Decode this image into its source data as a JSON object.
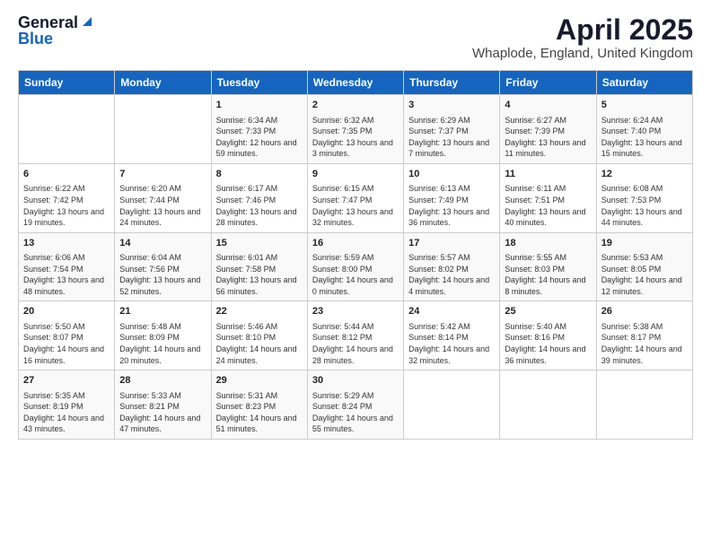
{
  "logo": {
    "general": "General",
    "blue": "Blue"
  },
  "title": "April 2025",
  "subtitle": "Whaplode, England, United Kingdom",
  "days_of_week": [
    "Sunday",
    "Monday",
    "Tuesday",
    "Wednesday",
    "Thursday",
    "Friday",
    "Saturday"
  ],
  "weeks": [
    [
      {
        "day": "",
        "sunrise": "",
        "sunset": "",
        "daylight": ""
      },
      {
        "day": "",
        "sunrise": "",
        "sunset": "",
        "daylight": ""
      },
      {
        "day": "1",
        "sunrise": "Sunrise: 6:34 AM",
        "sunset": "Sunset: 7:33 PM",
        "daylight": "Daylight: 12 hours and 59 minutes."
      },
      {
        "day": "2",
        "sunrise": "Sunrise: 6:32 AM",
        "sunset": "Sunset: 7:35 PM",
        "daylight": "Daylight: 13 hours and 3 minutes."
      },
      {
        "day": "3",
        "sunrise": "Sunrise: 6:29 AM",
        "sunset": "Sunset: 7:37 PM",
        "daylight": "Daylight: 13 hours and 7 minutes."
      },
      {
        "day": "4",
        "sunrise": "Sunrise: 6:27 AM",
        "sunset": "Sunset: 7:39 PM",
        "daylight": "Daylight: 13 hours and 11 minutes."
      },
      {
        "day": "5",
        "sunrise": "Sunrise: 6:24 AM",
        "sunset": "Sunset: 7:40 PM",
        "daylight": "Daylight: 13 hours and 15 minutes."
      }
    ],
    [
      {
        "day": "6",
        "sunrise": "Sunrise: 6:22 AM",
        "sunset": "Sunset: 7:42 PM",
        "daylight": "Daylight: 13 hours and 19 minutes."
      },
      {
        "day": "7",
        "sunrise": "Sunrise: 6:20 AM",
        "sunset": "Sunset: 7:44 PM",
        "daylight": "Daylight: 13 hours and 24 minutes."
      },
      {
        "day": "8",
        "sunrise": "Sunrise: 6:17 AM",
        "sunset": "Sunset: 7:46 PM",
        "daylight": "Daylight: 13 hours and 28 minutes."
      },
      {
        "day": "9",
        "sunrise": "Sunrise: 6:15 AM",
        "sunset": "Sunset: 7:47 PM",
        "daylight": "Daylight: 13 hours and 32 minutes."
      },
      {
        "day": "10",
        "sunrise": "Sunrise: 6:13 AM",
        "sunset": "Sunset: 7:49 PM",
        "daylight": "Daylight: 13 hours and 36 minutes."
      },
      {
        "day": "11",
        "sunrise": "Sunrise: 6:11 AM",
        "sunset": "Sunset: 7:51 PM",
        "daylight": "Daylight: 13 hours and 40 minutes."
      },
      {
        "day": "12",
        "sunrise": "Sunrise: 6:08 AM",
        "sunset": "Sunset: 7:53 PM",
        "daylight": "Daylight: 13 hours and 44 minutes."
      }
    ],
    [
      {
        "day": "13",
        "sunrise": "Sunrise: 6:06 AM",
        "sunset": "Sunset: 7:54 PM",
        "daylight": "Daylight: 13 hours and 48 minutes."
      },
      {
        "day": "14",
        "sunrise": "Sunrise: 6:04 AM",
        "sunset": "Sunset: 7:56 PM",
        "daylight": "Daylight: 13 hours and 52 minutes."
      },
      {
        "day": "15",
        "sunrise": "Sunrise: 6:01 AM",
        "sunset": "Sunset: 7:58 PM",
        "daylight": "Daylight: 13 hours and 56 minutes."
      },
      {
        "day": "16",
        "sunrise": "Sunrise: 5:59 AM",
        "sunset": "Sunset: 8:00 PM",
        "daylight": "Daylight: 14 hours and 0 minutes."
      },
      {
        "day": "17",
        "sunrise": "Sunrise: 5:57 AM",
        "sunset": "Sunset: 8:02 PM",
        "daylight": "Daylight: 14 hours and 4 minutes."
      },
      {
        "day": "18",
        "sunrise": "Sunrise: 5:55 AM",
        "sunset": "Sunset: 8:03 PM",
        "daylight": "Daylight: 14 hours and 8 minutes."
      },
      {
        "day": "19",
        "sunrise": "Sunrise: 5:53 AM",
        "sunset": "Sunset: 8:05 PM",
        "daylight": "Daylight: 14 hours and 12 minutes."
      }
    ],
    [
      {
        "day": "20",
        "sunrise": "Sunrise: 5:50 AM",
        "sunset": "Sunset: 8:07 PM",
        "daylight": "Daylight: 14 hours and 16 minutes."
      },
      {
        "day": "21",
        "sunrise": "Sunrise: 5:48 AM",
        "sunset": "Sunset: 8:09 PM",
        "daylight": "Daylight: 14 hours and 20 minutes."
      },
      {
        "day": "22",
        "sunrise": "Sunrise: 5:46 AM",
        "sunset": "Sunset: 8:10 PM",
        "daylight": "Daylight: 14 hours and 24 minutes."
      },
      {
        "day": "23",
        "sunrise": "Sunrise: 5:44 AM",
        "sunset": "Sunset: 8:12 PM",
        "daylight": "Daylight: 14 hours and 28 minutes."
      },
      {
        "day": "24",
        "sunrise": "Sunrise: 5:42 AM",
        "sunset": "Sunset: 8:14 PM",
        "daylight": "Daylight: 14 hours and 32 minutes."
      },
      {
        "day": "25",
        "sunrise": "Sunrise: 5:40 AM",
        "sunset": "Sunset: 8:16 PM",
        "daylight": "Daylight: 14 hours and 36 minutes."
      },
      {
        "day": "26",
        "sunrise": "Sunrise: 5:38 AM",
        "sunset": "Sunset: 8:17 PM",
        "daylight": "Daylight: 14 hours and 39 minutes."
      }
    ],
    [
      {
        "day": "27",
        "sunrise": "Sunrise: 5:35 AM",
        "sunset": "Sunset: 8:19 PM",
        "daylight": "Daylight: 14 hours and 43 minutes."
      },
      {
        "day": "28",
        "sunrise": "Sunrise: 5:33 AM",
        "sunset": "Sunset: 8:21 PM",
        "daylight": "Daylight: 14 hours and 47 minutes."
      },
      {
        "day": "29",
        "sunrise": "Sunrise: 5:31 AM",
        "sunset": "Sunset: 8:23 PM",
        "daylight": "Daylight: 14 hours and 51 minutes."
      },
      {
        "day": "30",
        "sunrise": "Sunrise: 5:29 AM",
        "sunset": "Sunset: 8:24 PM",
        "daylight": "Daylight: 14 hours and 55 minutes."
      },
      {
        "day": "",
        "sunrise": "",
        "sunset": "",
        "daylight": ""
      },
      {
        "day": "",
        "sunrise": "",
        "sunset": "",
        "daylight": ""
      },
      {
        "day": "",
        "sunrise": "",
        "sunset": "",
        "daylight": ""
      }
    ]
  ]
}
